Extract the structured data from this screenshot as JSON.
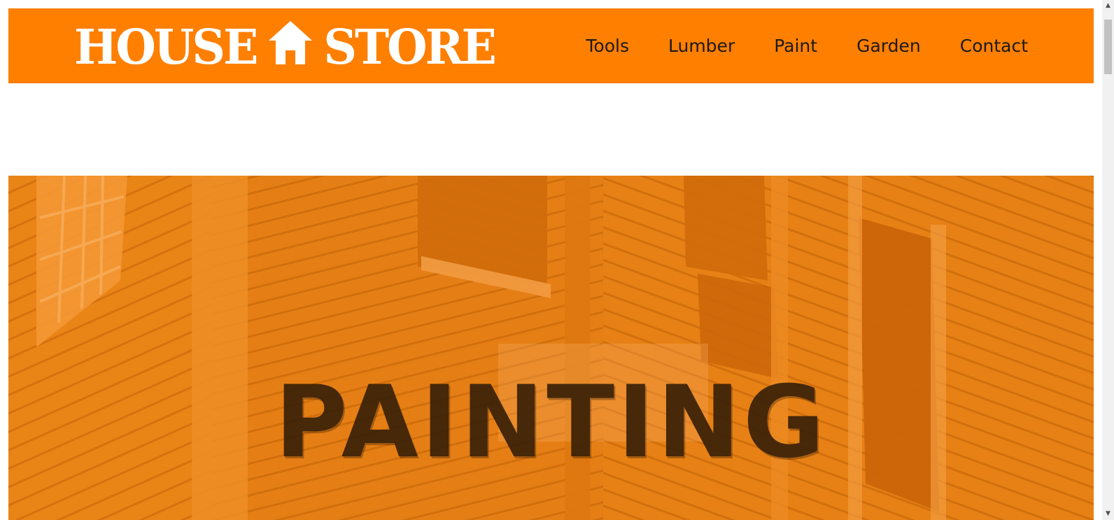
{
  "header": {
    "logo": {
      "word_left": "HOUSE",
      "word_right": "STORE",
      "icon": "house-icon"
    },
    "nav": [
      {
        "label": "Tools"
      },
      {
        "label": "Lumber"
      },
      {
        "label": "Paint"
      },
      {
        "label": "Garden"
      },
      {
        "label": "Contact"
      }
    ]
  },
  "hero": {
    "title": "PAINTING",
    "background": "orange-tinted photo of wooden house siding and windows"
  },
  "scrollbar": {
    "up_icon": "scroll-up-arrow-icon",
    "down_icon": "scroll-down-arrow-icon"
  },
  "colors": {
    "brand": "#ff7f00",
    "nav_text": "#1a1a1a",
    "hero_tint": "#e07a12",
    "hero_title": "#3a2108"
  }
}
